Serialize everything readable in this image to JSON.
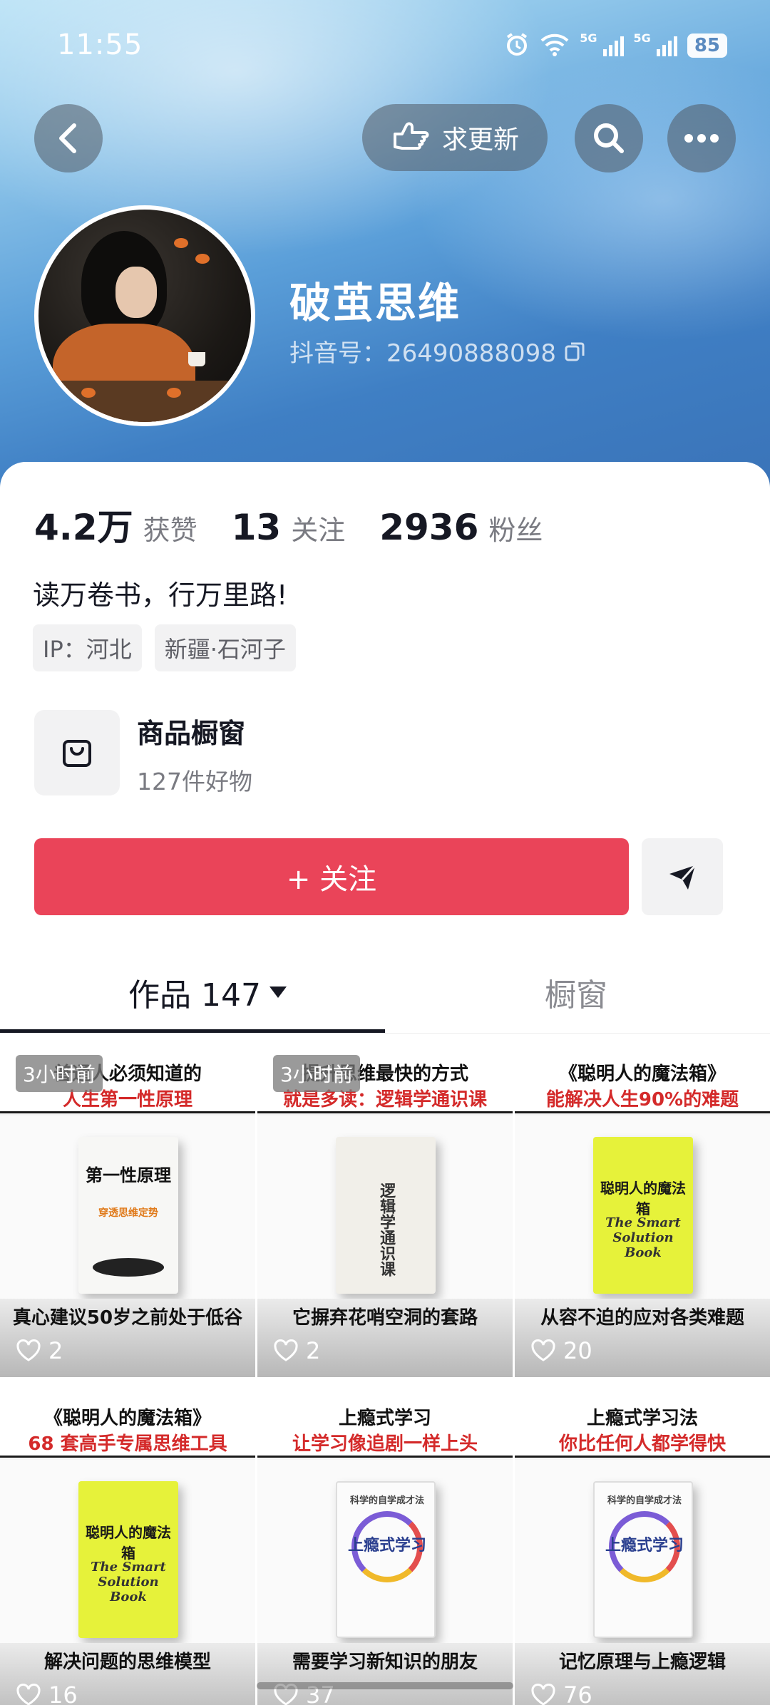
{
  "status_bar": {
    "time": "11:55",
    "battery": "85",
    "net1": "5G",
    "net2": "5G"
  },
  "top_bar": {
    "request_update_label": "求更新"
  },
  "profile": {
    "name": "破茧思维",
    "douyin_id": "抖音号：26490888098",
    "stats": [
      {
        "value": "4.2万",
        "label": "获赞"
      },
      {
        "value": "13",
        "label": "关注"
      },
      {
        "value": "2936",
        "label": "粉丝"
      }
    ],
    "bio": "读万卷书，行万里路!",
    "tags": [
      "IP：河北",
      "新疆·石河子"
    ]
  },
  "showcase": {
    "title": "商品橱窗",
    "subtitle": "127件好物"
  },
  "actions": {
    "follow_label": "+ 关注"
  },
  "tabs": {
    "works": "作品 147",
    "showcase": "橱窗"
  },
  "videos": [
    {
      "badge": "3小时前",
      "title1": "普通人必须知道的",
      "title2": "人生第一性原理",
      "book_title": "第一性原理",
      "book_sub": "穿透思维定势",
      "caption": "真心建议50岁之前处于低谷",
      "likes": "2"
    },
    {
      "badge": "3小时前",
      "title1": "提升思维最快的方式",
      "title2": "就是多读：逻辑学通识课",
      "book_title": "逻辑学通识课",
      "book_sub": "",
      "caption": "它摒弃花哨空洞的套路",
      "likes": "2"
    },
    {
      "badge": "",
      "title1": "《聪明人的魔法箱》",
      "title2": "能解决人生90%的难题",
      "book_title": "聪明人的魔法箱",
      "book_sub": "The Smart Solution Book",
      "caption": "从容不迫的应对各类难题",
      "likes": "20"
    },
    {
      "badge": "",
      "title1": "《聪明人的魔法箱》",
      "title2": "68 套高手专属思维工具",
      "book_title": "聪明人的魔法箱",
      "book_sub": "The Smart Solution Book",
      "caption": "解决问题的思维模型",
      "likes": "16"
    },
    {
      "badge": "",
      "title1": "上瘾式学习",
      "title2": "让学习像追剧一样上头",
      "book_title": "上瘾式学习",
      "book_sub": "科学的自学成才法",
      "caption": "需要学习新知识的朋友",
      "likes": "37"
    },
    {
      "badge": "",
      "title1": "上瘾式学习法",
      "title2": "你比任何人都学得快",
      "book_title": "上瘾式学习",
      "book_sub": "科学的自学成才法",
      "caption": "记忆原理与上瘾逻辑",
      "likes": "76"
    }
  ]
}
